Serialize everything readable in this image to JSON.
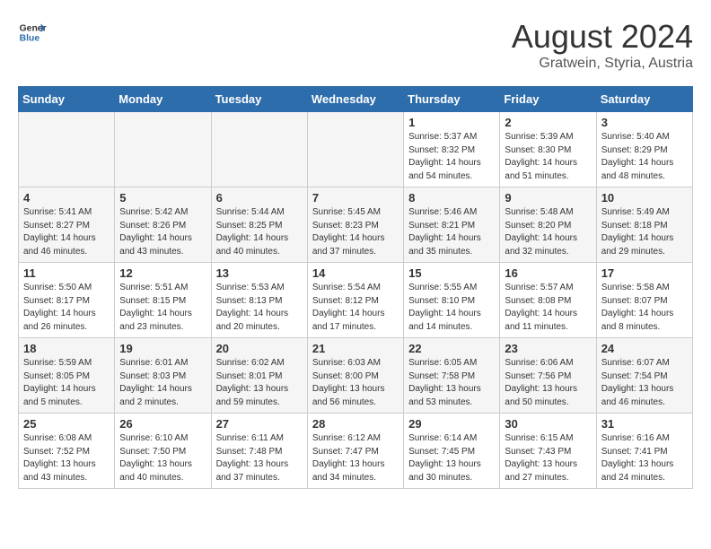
{
  "header": {
    "logo_line1": "General",
    "logo_line2": "Blue",
    "month": "August 2024",
    "location": "Gratwein, Styria, Austria"
  },
  "weekdays": [
    "Sunday",
    "Monday",
    "Tuesday",
    "Wednesday",
    "Thursday",
    "Friday",
    "Saturday"
  ],
  "weeks": [
    [
      {
        "day": "",
        "empty": true
      },
      {
        "day": "",
        "empty": true
      },
      {
        "day": "",
        "empty": true
      },
      {
        "day": "",
        "empty": true
      },
      {
        "day": "1",
        "info": "Sunrise: 5:37 AM\nSunset: 8:32 PM\nDaylight: 14 hours\nand 54 minutes."
      },
      {
        "day": "2",
        "info": "Sunrise: 5:39 AM\nSunset: 8:30 PM\nDaylight: 14 hours\nand 51 minutes."
      },
      {
        "day": "3",
        "info": "Sunrise: 5:40 AM\nSunset: 8:29 PM\nDaylight: 14 hours\nand 48 minutes."
      }
    ],
    [
      {
        "day": "4",
        "info": "Sunrise: 5:41 AM\nSunset: 8:27 PM\nDaylight: 14 hours\nand 46 minutes."
      },
      {
        "day": "5",
        "info": "Sunrise: 5:42 AM\nSunset: 8:26 PM\nDaylight: 14 hours\nand 43 minutes."
      },
      {
        "day": "6",
        "info": "Sunrise: 5:44 AM\nSunset: 8:25 PM\nDaylight: 14 hours\nand 40 minutes."
      },
      {
        "day": "7",
        "info": "Sunrise: 5:45 AM\nSunset: 8:23 PM\nDaylight: 14 hours\nand 37 minutes."
      },
      {
        "day": "8",
        "info": "Sunrise: 5:46 AM\nSunset: 8:21 PM\nDaylight: 14 hours\nand 35 minutes."
      },
      {
        "day": "9",
        "info": "Sunrise: 5:48 AM\nSunset: 8:20 PM\nDaylight: 14 hours\nand 32 minutes."
      },
      {
        "day": "10",
        "info": "Sunrise: 5:49 AM\nSunset: 8:18 PM\nDaylight: 14 hours\nand 29 minutes."
      }
    ],
    [
      {
        "day": "11",
        "info": "Sunrise: 5:50 AM\nSunset: 8:17 PM\nDaylight: 14 hours\nand 26 minutes."
      },
      {
        "day": "12",
        "info": "Sunrise: 5:51 AM\nSunset: 8:15 PM\nDaylight: 14 hours\nand 23 minutes."
      },
      {
        "day": "13",
        "info": "Sunrise: 5:53 AM\nSunset: 8:13 PM\nDaylight: 14 hours\nand 20 minutes."
      },
      {
        "day": "14",
        "info": "Sunrise: 5:54 AM\nSunset: 8:12 PM\nDaylight: 14 hours\nand 17 minutes."
      },
      {
        "day": "15",
        "info": "Sunrise: 5:55 AM\nSunset: 8:10 PM\nDaylight: 14 hours\nand 14 minutes."
      },
      {
        "day": "16",
        "info": "Sunrise: 5:57 AM\nSunset: 8:08 PM\nDaylight: 14 hours\nand 11 minutes."
      },
      {
        "day": "17",
        "info": "Sunrise: 5:58 AM\nSunset: 8:07 PM\nDaylight: 14 hours\nand 8 minutes."
      }
    ],
    [
      {
        "day": "18",
        "info": "Sunrise: 5:59 AM\nSunset: 8:05 PM\nDaylight: 14 hours\nand 5 minutes."
      },
      {
        "day": "19",
        "info": "Sunrise: 6:01 AM\nSunset: 8:03 PM\nDaylight: 14 hours\nand 2 minutes."
      },
      {
        "day": "20",
        "info": "Sunrise: 6:02 AM\nSunset: 8:01 PM\nDaylight: 13 hours\nand 59 minutes."
      },
      {
        "day": "21",
        "info": "Sunrise: 6:03 AM\nSunset: 8:00 PM\nDaylight: 13 hours\nand 56 minutes."
      },
      {
        "day": "22",
        "info": "Sunrise: 6:05 AM\nSunset: 7:58 PM\nDaylight: 13 hours\nand 53 minutes."
      },
      {
        "day": "23",
        "info": "Sunrise: 6:06 AM\nSunset: 7:56 PM\nDaylight: 13 hours\nand 50 minutes."
      },
      {
        "day": "24",
        "info": "Sunrise: 6:07 AM\nSunset: 7:54 PM\nDaylight: 13 hours\nand 46 minutes."
      }
    ],
    [
      {
        "day": "25",
        "info": "Sunrise: 6:08 AM\nSunset: 7:52 PM\nDaylight: 13 hours\nand 43 minutes."
      },
      {
        "day": "26",
        "info": "Sunrise: 6:10 AM\nSunset: 7:50 PM\nDaylight: 13 hours\nand 40 minutes."
      },
      {
        "day": "27",
        "info": "Sunrise: 6:11 AM\nSunset: 7:48 PM\nDaylight: 13 hours\nand 37 minutes."
      },
      {
        "day": "28",
        "info": "Sunrise: 6:12 AM\nSunset: 7:47 PM\nDaylight: 13 hours\nand 34 minutes."
      },
      {
        "day": "29",
        "info": "Sunrise: 6:14 AM\nSunset: 7:45 PM\nDaylight: 13 hours\nand 30 minutes."
      },
      {
        "day": "30",
        "info": "Sunrise: 6:15 AM\nSunset: 7:43 PM\nDaylight: 13 hours\nand 27 minutes."
      },
      {
        "day": "31",
        "info": "Sunrise: 6:16 AM\nSunset: 7:41 PM\nDaylight: 13 hours\nand 24 minutes."
      }
    ]
  ]
}
